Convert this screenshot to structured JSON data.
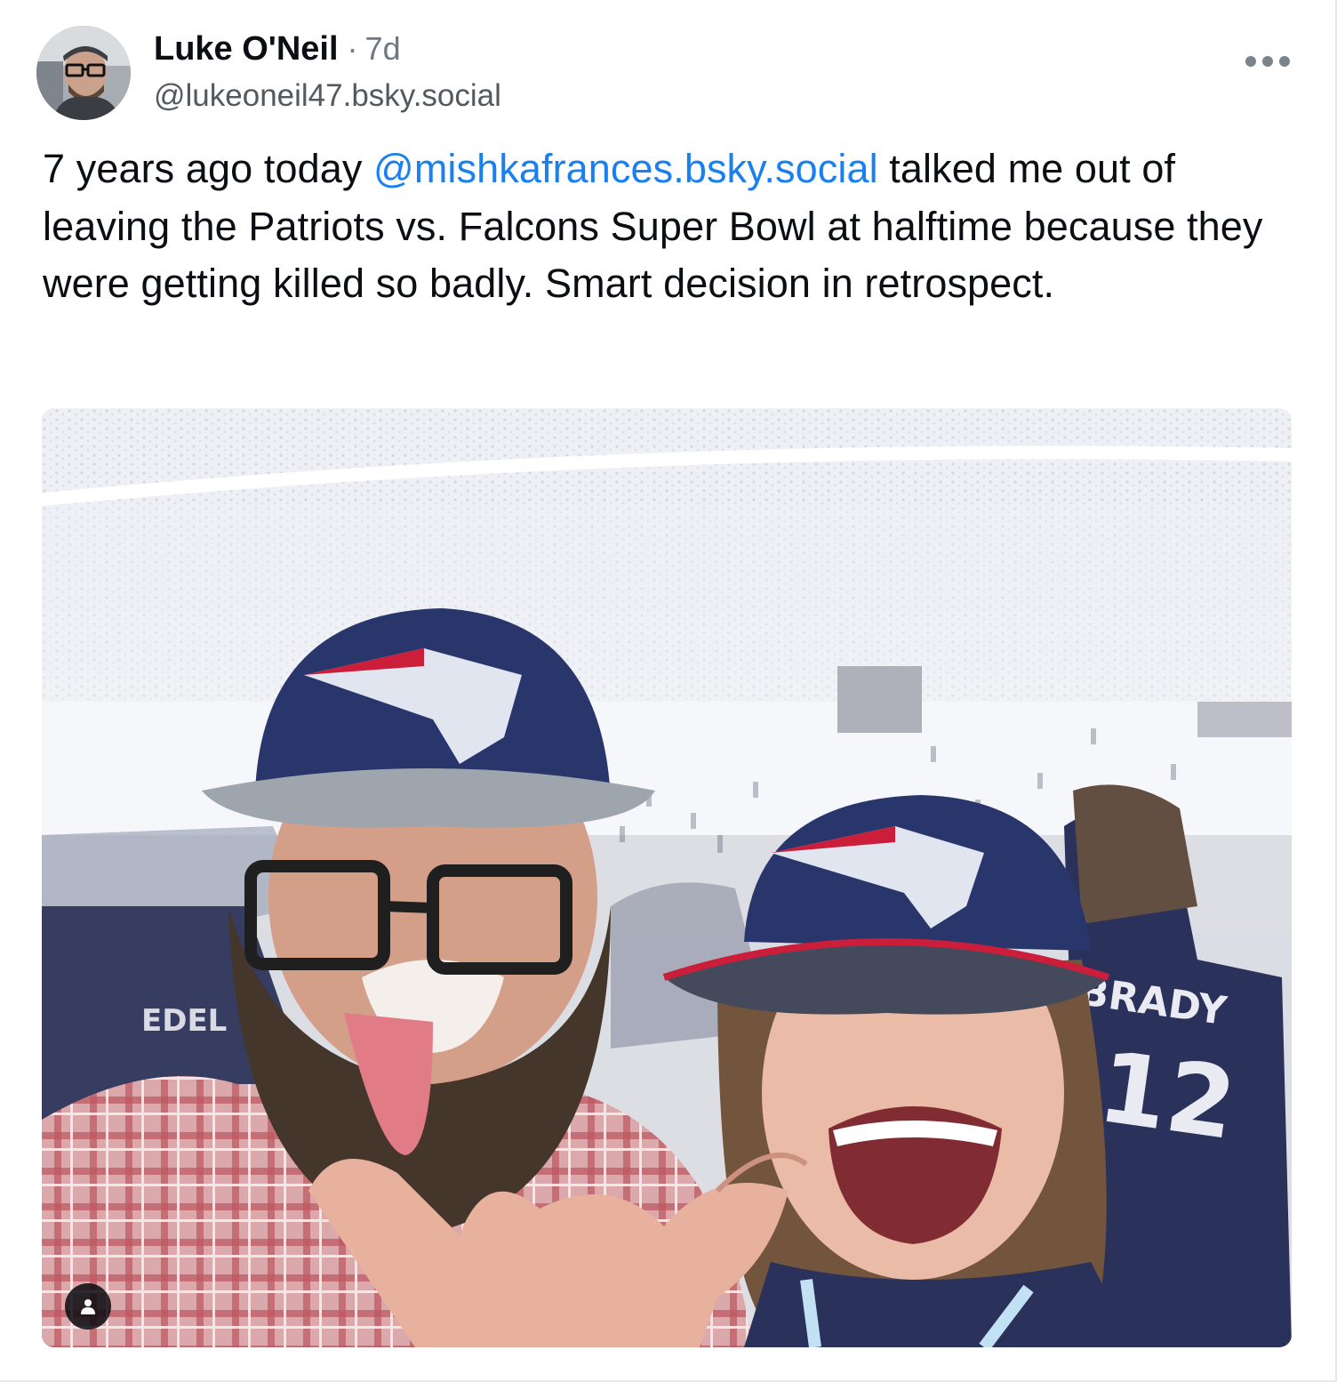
{
  "post": {
    "author": {
      "display_name": "Luke O'Neil",
      "handle": "@lukeoneil47.bsky.social",
      "separator": "·",
      "time": "7d"
    },
    "text": {
      "before_mention": "7 years ago today ",
      "mention": "@mishkafrances.bsky.social",
      "after_mention": " talked me out of leaving the Patriots vs. Falcons Super Bowl at halftime because they were getting killed so badly. Smart decision in retrospect."
    },
    "image": {
      "jersey_left": "EDEL",
      "jersey_right_name": "BRADY",
      "jersey_right_number": "12"
    },
    "icons": {
      "more": "ellipsis-icon",
      "alt": "person-icon"
    },
    "colors": {
      "mention": "#1a80ef",
      "muted": "#6f7780",
      "cap_navy": "#1b2a63",
      "cap_red": "#c8102e"
    }
  }
}
